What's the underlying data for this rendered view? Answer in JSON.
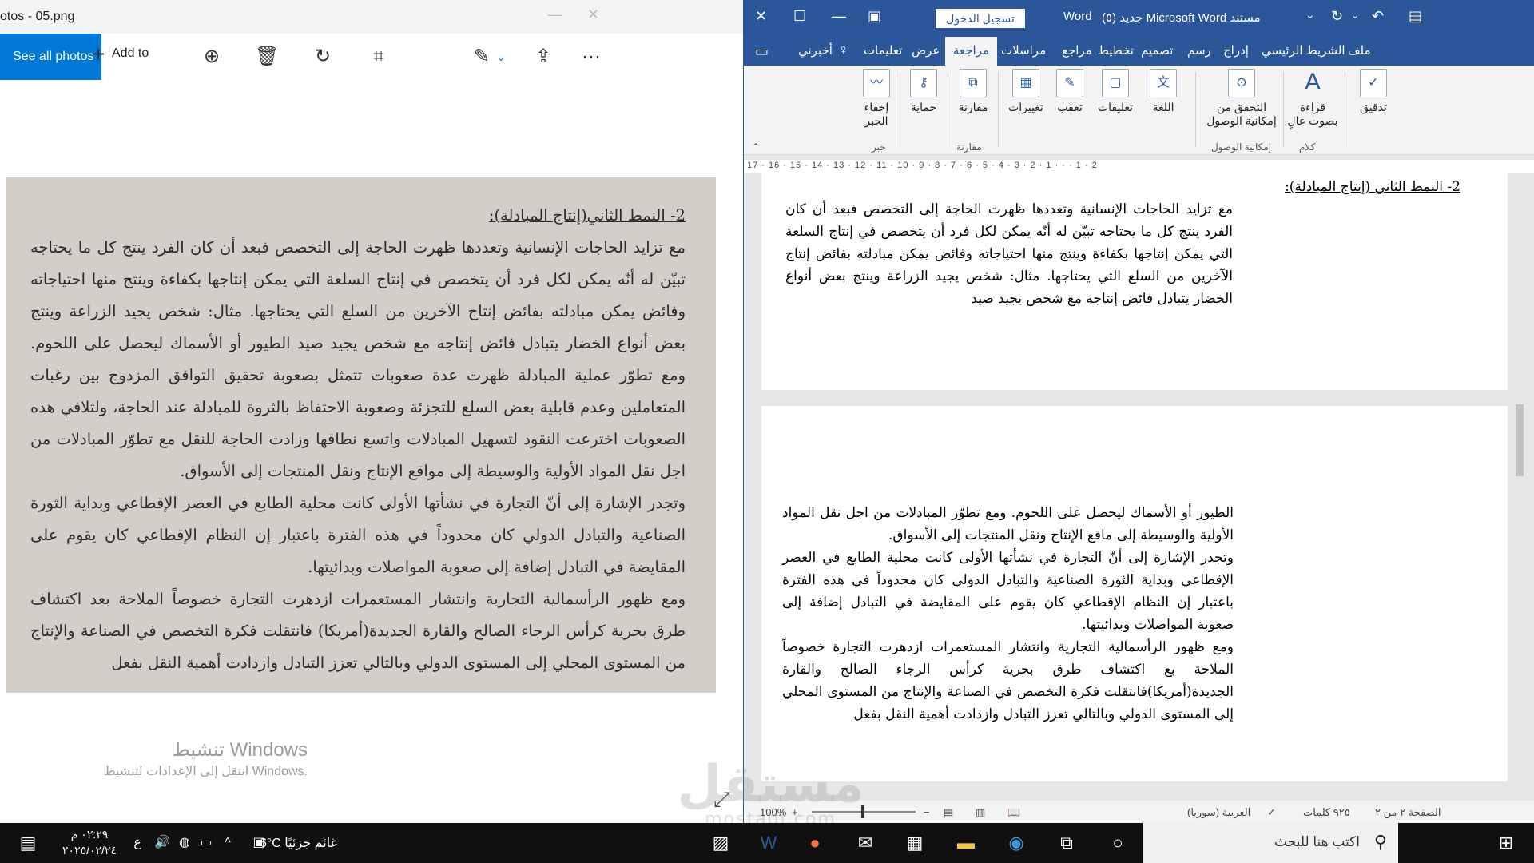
{
  "photos": {
    "title": "otos - 05.png",
    "see_all_label": "See all photos",
    "add_to_label": "Add to",
    "more_label": "···",
    "activate_title": "تنشيط Windows",
    "activate_sub": "انتقل إلى الإعدادات لتنشيط Windows.",
    "image_text": {
      "heading": "2- النمط الثاني(إنتاج المبادلة):",
      "para1": "مع تزايد الحاجات الإنسانية وتعددها ظهرت الحاجة إلى التخصص فبعد أن كان الفرد ينتج كل ما يحتاجه تبيّن له أنّه يمكن لكل فرد أن يتخصص في إنتاج السلعة التي يمكن إنتاجها بكفاءة وينتج منها احتياجاته وفائض يمكن مبادلته بفائض إنتاج الآخرين من السلع التي يحتاجها. مثال: شخص يجيد الزراعة وينتج بعض أنواع الخضار يتبادل فائض إنتاجه مع شخص يجيد صيد الطيور أو الأسماك ليحصل على اللحوم. ومع تطوّر عملية المبادلة ظهرت عدة صعوبات تتمثل بصعوبة تحقيق التوافق المزدوج بين رغبات المتعاملين وعدم قابلية بعض السلع للتجزئة وصعوبة الاحتفاظ بالثروة للمبادلة عند الحاجة، ولتلافي هذه الصعوبات اخترعت النقود لتسهيل المبادلات واتسع نطاقها وزادت الحاجة للنقل مع تطوّر المبادلات من اجل نقل المواد الأولية والوسيطة إلى مواقع الإنتاج ونقل المنتجات إلى الأسواق.",
      "para2": "وتجدر الإشارة إلى أنّ التجارة في نشأتها الأولى كانت محلية الطابع في العصر الإقطاعي وبداية الثورة الصناعية والتبادل الدولي كان محدوداً في هذه الفترة باعتبار إن النظام الإقطاعي كان يقوم على المقايضة في التبادل إضافة إلى صعوبة المواصلات وبدائيتها.",
      "para3": "ومع ظهور الرأسمالية التجارية وانتشار المستعمرات ازدهرت التجارة خصوصاً الملاحة بعد اكتشاف طرق بحرية كرأس الرجاء الصالح والقارة الجديدة(أمريكا) فانتقلت فكرة التخصص في الصناعة والإنتاج من المستوى المحلي إلى المستوى الدولي وبالتالي تعزز التبادل وازدادت أهمية النقل بفعل"
    }
  },
  "word": {
    "app_name": "Word",
    "doc_title": "مستند Microsoft Word جديد (٥)",
    "signin_label": "تسجيل الدخول",
    "tabs": [
      "ملف",
      "الشريط الرئيسي",
      "إدراج",
      "رسم",
      "تصميم",
      "تخطيط",
      "مراجع",
      "مراسلات",
      "مراجعة",
      "عرض",
      "تعليمات",
      "أخبرني"
    ],
    "ribbon": {
      "proofing_label": "تدقيق",
      "read_aloud_label": "قراءة بصوت عالٍ",
      "accessibility_label": "التحقق من إمكانية الوصول",
      "language_label": "اللغة",
      "comments_label": "تعليقات",
      "tracking_label": "تعقب",
      "changes_label": "تغييرات",
      "compare_label": "مقارنة",
      "protect_label": "حماية",
      "ink_label": "إخفاء الحبر",
      "group_speech": "كلام",
      "group_accessibility": "إمكانية الوصول",
      "group_compare": "مقارنة",
      "group_ink": "حبر"
    },
    "ruler_ticks": "17 · 16 · 15 · 14 · 13 · 12 · 11 · 10 · 9 · 8 · 7 · 6 · 5 · 4 · 3 · 2 · 1 · · · 1 · 2",
    "page1": {
      "heading": "2- النمط الثاني (إنتاج المبادلة):",
      "text": "مع تزايد الحاجات الإنسانية وتعددها ظهرت الحاجة إلى التخصص فبعد أن كان الفرد ينتج كل ما يحتاجه تبيّن له أنّه يمكن لكل فرد أن يتخصص في إنتاج السلعة التي يمكن إنتاجها بكفاءة وينتج منها احتياجاته وفائض يمكن مبادلته بفائض إنتاج الآخرين من السلع التي يحتاجها. مثال: شخص يجيد الزراعة وينتج بعض أنواع الخضار يتبادل فائض إنتاجه مع شخص يجيد صيد"
    },
    "page2": {
      "para1": "الطيور أو الأسماك ليحصل على اللحوم. ومع تطوّر المبادلات من اجل نقل المواد الأولية والوسيطة إلى ماقع الإنتاج ونقل المنتجات إلى الأسواق.",
      "para2": "وتجدر الإشارة إلى أنّ التجارة في نشأتها الأولى كانت محلية الطابع في العصر الإقطاعي وبداية الثورة الصناعية والتبادل الدولي كان محدوداً في هذه الفترة باعتبار إن النظام الإقطاعي كان يقوم على المقايضة في التبادل إضافة إلى صعوبة المواصلات وبدائيتها.",
      "para3": "ومع ظهور الرأسمالية التجارية وانتشار المستعمرات ازدهرت التجارة خصوصاً الملاحة بع اكتشاف طرق بحرية كرأس الرجاء الصالح والقارة الجديدة(أمريكا)فانتقلت فكرة التخصص في الصناعة والإنتاج من المستوى المحلي إلى المستوى الدولي وبالتالي تعزز التبادل وازدادت أهمية النقل بفعل"
    },
    "status": {
      "page": "الصفحة ٢ من ٢",
      "words": "٩٢٥ كلمات",
      "language": "العربية (سوريا)",
      "zoom": "100%"
    }
  },
  "watermark": {
    "line1": "مستقل",
    "line2": "mostaql.com"
  },
  "taskbar": {
    "search_placeholder": "اكتب هنا للبحث",
    "weather": "6°C غائم جزئيًا",
    "time": "٠٢:٢٩ م",
    "date": "٢٠٢٥/٠٢/٢٤",
    "lang": "ع"
  }
}
